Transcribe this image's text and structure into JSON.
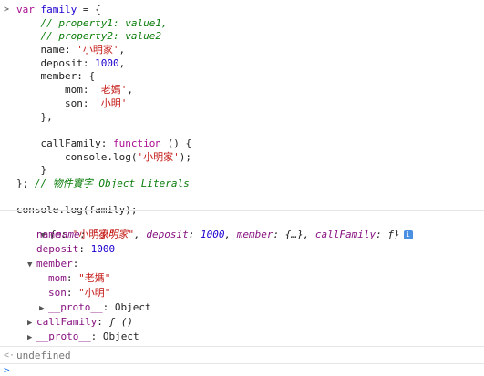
{
  "input": {
    "prompt_glyph": ">",
    "lines": [
      {
        "k": "code_var",
        "t": "var family = {"
      },
      {
        "k": "cm",
        "t": "    // property1: value1,"
      },
      {
        "k": "cm",
        "t": "    // property2: value2"
      },
      {
        "k": "kv_str",
        "key": "    name: ",
        "val": "'小明家'",
        "tail": ","
      },
      {
        "k": "kv_num",
        "key": "    deposit: ",
        "val": "1000",
        "tail": ","
      },
      {
        "k": "plain",
        "t": "    member: {"
      },
      {
        "k": "kv_str",
        "key": "        mom: ",
        "val": "'老媽'",
        "tail": ","
      },
      {
        "k": "kv_str",
        "key": "        son: ",
        "val": "'小明'",
        "tail": ""
      },
      {
        "k": "plain",
        "t": "    },"
      },
      {
        "k": "plain",
        "t": ""
      },
      {
        "k": "fn",
        "key": "    callFamily: ",
        "fnkw": "function",
        "tail": " () {"
      },
      {
        "k": "log",
        "pre": "        console.log(",
        "val": "'小明家'",
        "tail": ");"
      },
      {
        "k": "plain",
        "t": "    }"
      },
      {
        "k": "endcm",
        "pre": "}; ",
        "cm": "// 物件實字 Object Literals"
      },
      {
        "k": "plain",
        "t": ""
      },
      {
        "k": "plain",
        "t": "console.log(family);"
      }
    ]
  },
  "output": {
    "summary": {
      "open": "{",
      "name_key": "name",
      "name_val": "\"小明家\"",
      "deposit_key": "deposit",
      "deposit_val": "1000",
      "member_key": "member",
      "member_val": "{…}",
      "callFamily_key": "callFamily",
      "callFamily_val": "ƒ",
      "close": "}",
      "info_glyph": "i"
    },
    "rows": {
      "name_key": "name",
      "name_val": "\"小明家\"",
      "deposit_key": "deposit",
      "deposit_val": "1000",
      "member_key": "member",
      "mom_key": "mom",
      "mom_val": "\"老媽\"",
      "son_key": "son",
      "son_val": "\"小明\"",
      "proto_key": "__proto__",
      "proto_val": "Object",
      "callFamily_key": "callFamily",
      "callFamily_val": "ƒ ()",
      "proto2_key": "__proto__",
      "proto2_val": "Object"
    },
    "result": {
      "glyph": "<·",
      "text": "undefined"
    },
    "next_prompt": ">"
  }
}
